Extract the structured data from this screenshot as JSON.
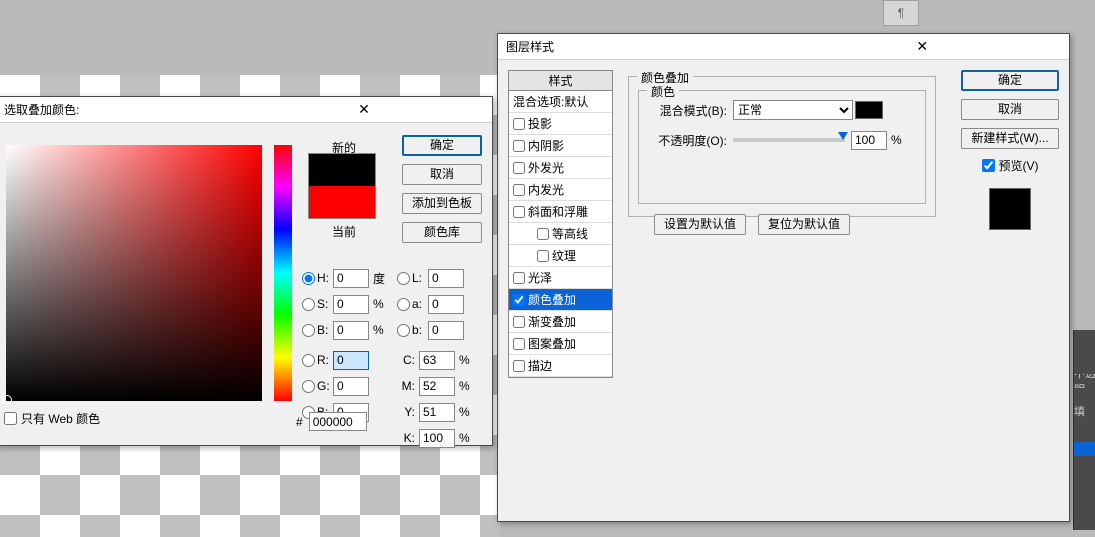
{
  "toolbar": {
    "pilcrow": "¶"
  },
  "color_picker": {
    "title": "选取叠加颜色:",
    "new_label": "新的",
    "current_label": "当前",
    "ok": "确定",
    "cancel": "取消",
    "add_swatch": "添加到色板",
    "color_lib": "颜色库",
    "hsb": {
      "h_label": "H:",
      "h_val": "0",
      "h_unit": "度",
      "s_label": "S:",
      "s_val": "0",
      "s_unit": "%",
      "b_label": "B:",
      "b_val": "0",
      "b_unit": "%"
    },
    "lab": {
      "l_label": "L:",
      "l_val": "0",
      "a_label": "a:",
      "a_val": "0",
      "b_label": "b:",
      "b_val": "0"
    },
    "rgb": {
      "r_label": "R:",
      "r_val": "0",
      "g_label": "G:",
      "g_val": "0",
      "b_label": "B:",
      "b_val": "0"
    },
    "cmyk": {
      "c_label": "C:",
      "c_val": "63",
      "unit": "%",
      "m_label": "M:",
      "m_val": "52",
      "y_label": "Y:",
      "y_val": "51",
      "k_label": "K:",
      "k_val": "100"
    },
    "web_only": "只有 Web 颜色",
    "hex_prefix": "#",
    "hex_val": "000000"
  },
  "layer_style": {
    "title": "图层样式",
    "styles_header": "样式",
    "blend_options": "混合选项:默认",
    "items": [
      "投影",
      "内阴影",
      "外发光",
      "内发光",
      "斜面和浮雕",
      "等高线",
      "纹理",
      "光泽",
      "颜色叠加",
      "渐变叠加",
      "图案叠加",
      "描边"
    ],
    "overlay_group": "颜色叠加",
    "color_group": "颜色",
    "blend_mode_label": "混合模式(B):",
    "blend_mode_value": "正常",
    "opacity_label": "不透明度(O):",
    "opacity_value": "100",
    "opacity_unit": "%",
    "default_btn": "设置为默认值",
    "reset_btn": "复位为默认值",
    "ok": "确定",
    "cancel": "取消",
    "new_style": "新建样式(W)...",
    "preview": "预览(V)"
  },
  "rpanel": {
    "opacity": "不透明",
    "fill": "填"
  }
}
